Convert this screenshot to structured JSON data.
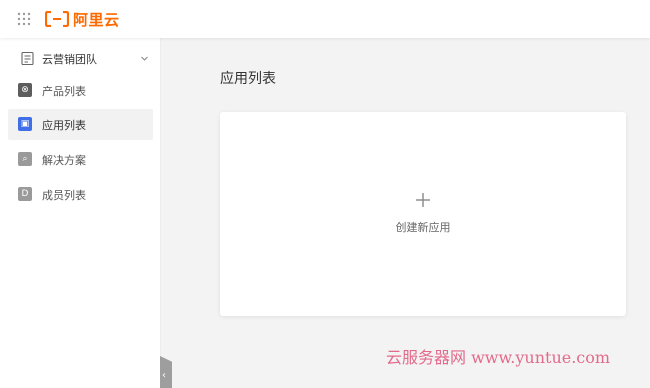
{
  "header": {
    "logo_text": "阿里云",
    "brand_color": "#ff6a00",
    "grid_icon": "apps-grid-icon"
  },
  "sidebar": {
    "team_label": "云营销团队",
    "team_icon": "team-icon",
    "expand_icon": "chevron-down-icon",
    "items": [
      {
        "label": "产品列表",
        "icon": "product-icon",
        "active": false
      },
      {
        "label": "应用列表",
        "icon": "app-icon",
        "active": true
      },
      {
        "label": "解决方案",
        "icon": "solution-icon",
        "active": false
      },
      {
        "label": "成员列表",
        "icon": "member-icon",
        "active": false
      }
    ],
    "collapse_glyph": "‹"
  },
  "main": {
    "title": "应用列表",
    "create_label": "创建新应用",
    "create_icon": "plus-icon"
  },
  "watermark": "云服务器网 www.yuntue.com"
}
